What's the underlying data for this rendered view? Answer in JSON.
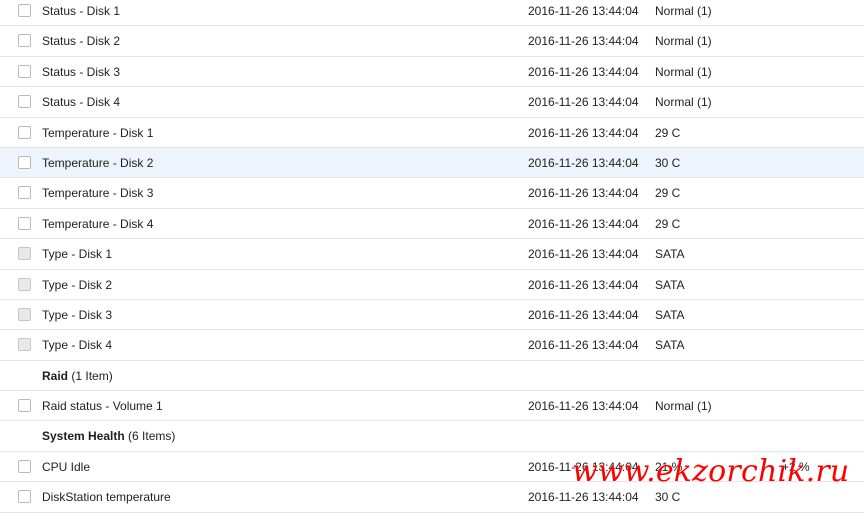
{
  "rows": [
    {
      "type": "item",
      "name": "Status - Disk 1",
      "time": "2016-11-26 13:44:04",
      "value": "Normal (1)",
      "change": "",
      "checkbox": "normal"
    },
    {
      "type": "item",
      "name": "Status - Disk 2",
      "time": "2016-11-26 13:44:04",
      "value": "Normal (1)",
      "change": "",
      "checkbox": "normal"
    },
    {
      "type": "item",
      "name": "Status - Disk 3",
      "time": "2016-11-26 13:44:04",
      "value": "Normal (1)",
      "change": "",
      "checkbox": "normal"
    },
    {
      "type": "item",
      "name": "Status - Disk 4",
      "time": "2016-11-26 13:44:04",
      "value": "Normal (1)",
      "change": "",
      "checkbox": "normal"
    },
    {
      "type": "item",
      "name": "Temperature - Disk 1",
      "time": "2016-11-26 13:44:04",
      "value": "29 C",
      "change": "",
      "checkbox": "normal"
    },
    {
      "type": "item",
      "name": "Temperature - Disk 2",
      "time": "2016-11-26 13:44:04",
      "value": "30 C",
      "change": "",
      "checkbox": "normal",
      "selected": true
    },
    {
      "type": "item",
      "name": "Temperature - Disk 3",
      "time": "2016-11-26 13:44:04",
      "value": "29 C",
      "change": "",
      "checkbox": "normal"
    },
    {
      "type": "item",
      "name": "Temperature - Disk 4",
      "time": "2016-11-26 13:44:04",
      "value": "29 C",
      "change": "",
      "checkbox": "normal"
    },
    {
      "type": "item",
      "name": "Type - Disk 1",
      "time": "2016-11-26 13:44:04",
      "value": "SATA",
      "change": "",
      "checkbox": "disabled"
    },
    {
      "type": "item",
      "name": "Type - Disk 2",
      "time": "2016-11-26 13:44:04",
      "value": "SATA",
      "change": "",
      "checkbox": "disabled"
    },
    {
      "type": "item",
      "name": "Type - Disk 3",
      "time": "2016-11-26 13:44:04",
      "value": "SATA",
      "change": "",
      "checkbox": "disabled"
    },
    {
      "type": "item",
      "name": "Type - Disk 4",
      "time": "2016-11-26 13:44:04",
      "value": "SATA",
      "change": "",
      "checkbox": "disabled"
    },
    {
      "type": "group",
      "title": "Raid",
      "count": "(1 Item)"
    },
    {
      "type": "item",
      "name": "Raid status - Volume 1",
      "time": "2016-11-26 13:44:04",
      "value": "Normal (1)",
      "change": "",
      "checkbox": "normal"
    },
    {
      "type": "group",
      "title": "System Health",
      "count": "(6 Items)"
    },
    {
      "type": "item",
      "name": "CPU Idle",
      "time": "2016-11-26 13:44:04",
      "value": "21 %",
      "change": "+2 %",
      "checkbox": "normal"
    },
    {
      "type": "item",
      "name": "DiskStation temperature",
      "time": "2016-11-26 13:44:04",
      "value": "30 C",
      "change": "",
      "checkbox": "normal"
    }
  ],
  "watermark": "www.ekzorchik.ru",
  "colors": {
    "selected_row": "#edf4fb",
    "divider": "#e6e6e6",
    "watermark": "#ff0000"
  }
}
